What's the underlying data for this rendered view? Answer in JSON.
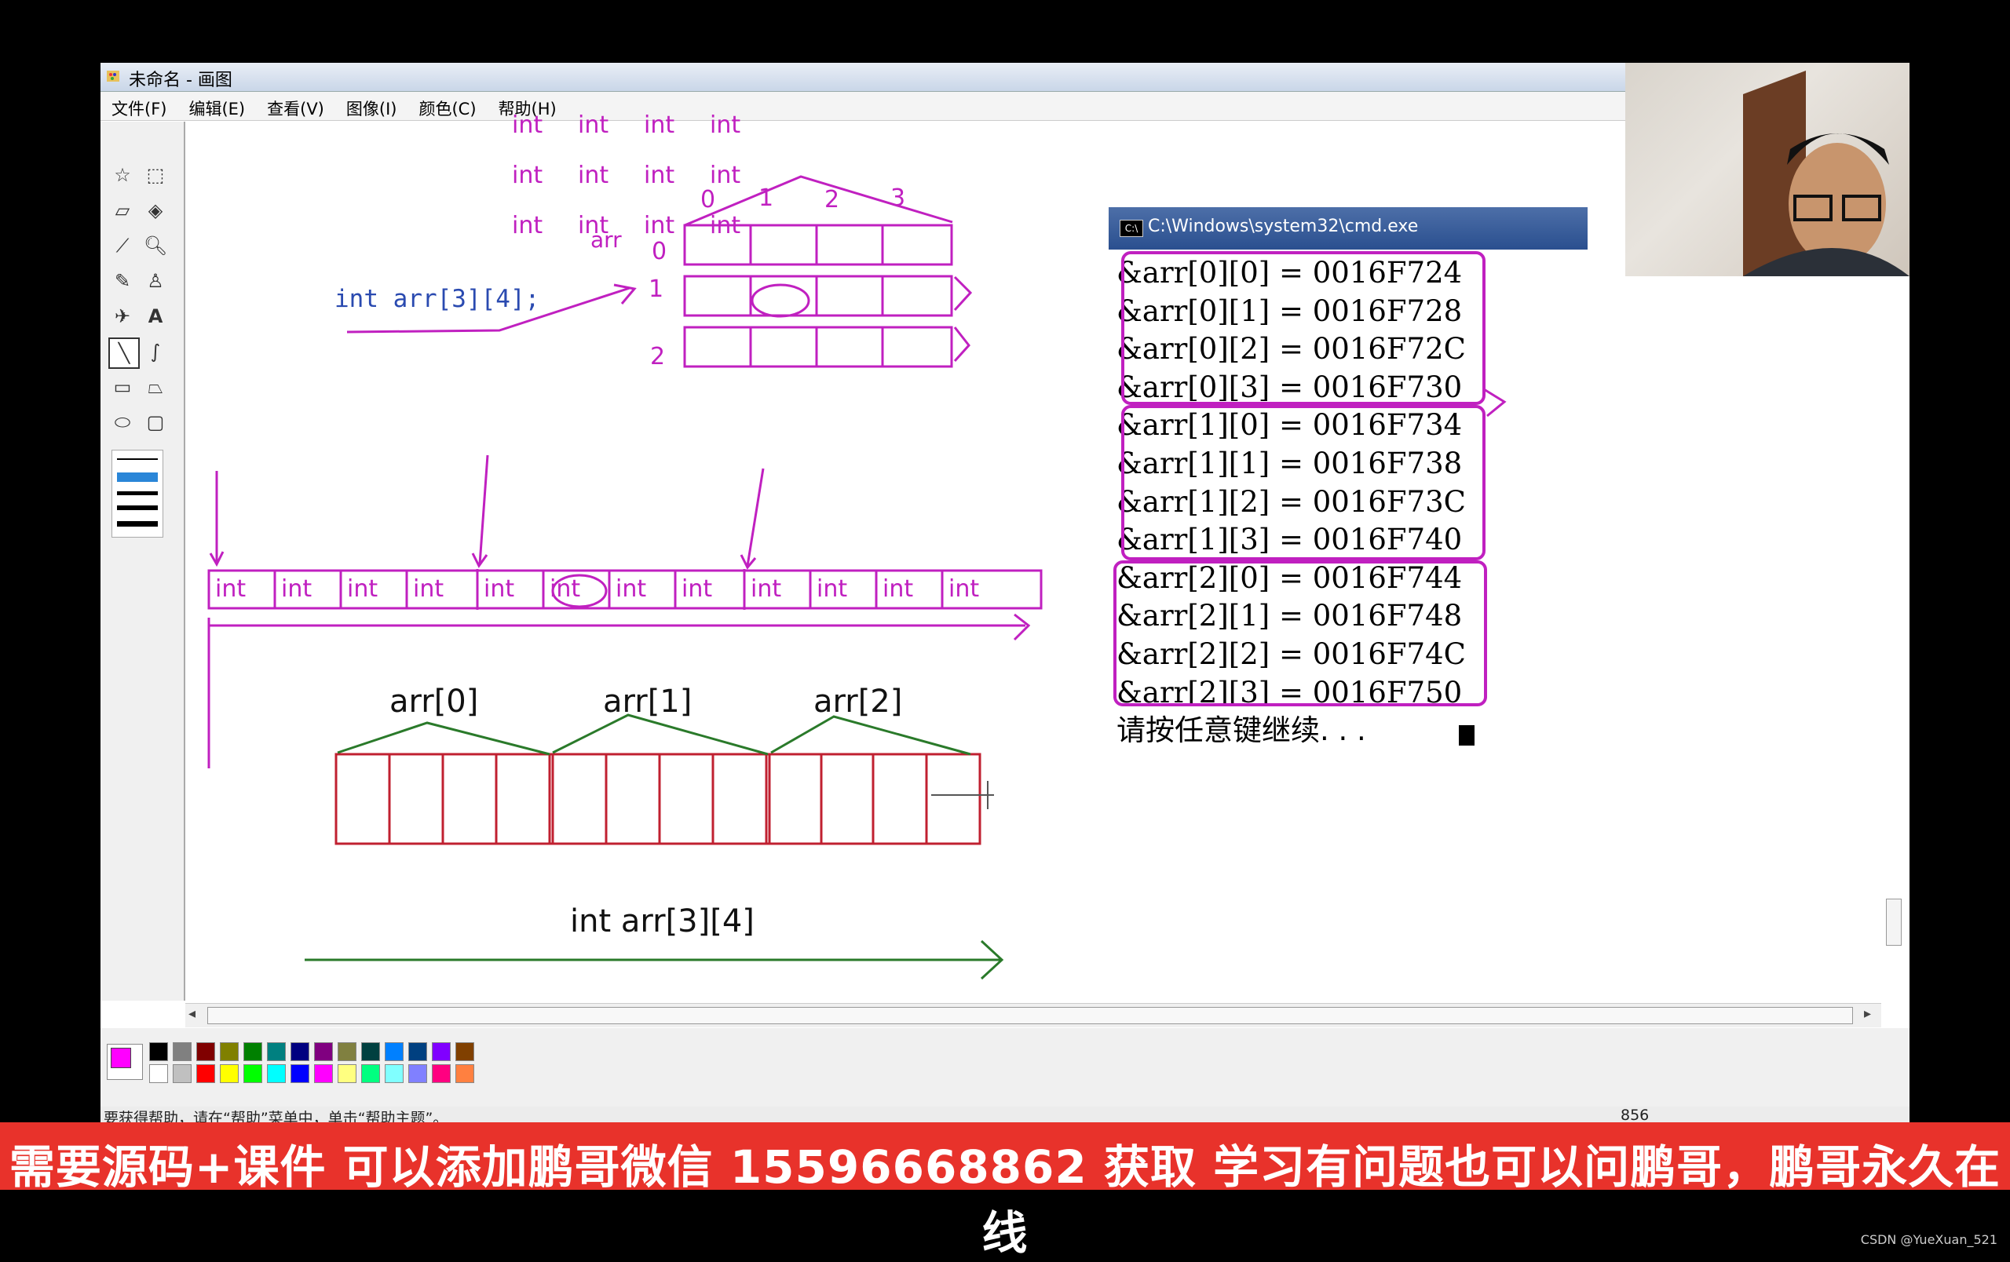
{
  "window": {
    "title": "未命名 - 画图",
    "menu": [
      "文件(F)",
      "编辑(E)",
      "查看(V)",
      "图像(I)",
      "颜色(C)",
      "帮助(H)"
    ]
  },
  "tools": [
    "free-select-icon",
    "rect-select-icon",
    "eraser-icon",
    "fill-icon",
    "color-picker-icon",
    "magnifier-icon",
    "pencil-icon",
    "brush-icon",
    "airbrush-icon",
    "text-icon",
    "line-icon",
    "curve-icon",
    "rectangle-icon",
    "polygon-icon",
    "ellipse-icon",
    "rounded-rect-icon"
  ],
  "drawing": {
    "declaration": "int arr[3][4];",
    "arr_label": "arr",
    "col_indices": [
      "0",
      "1",
      "2",
      "3"
    ],
    "row_indices": [
      "0",
      "1",
      "2"
    ],
    "cell_label": "int",
    "group_labels": [
      "arr[0]",
      "arr[1]",
      "arr[2]"
    ],
    "bottom_label": "int arr[3][4]"
  },
  "cmd": {
    "title": "C:\\Windows\\system32\\cmd.exe",
    "lines": [
      "&arr[0][0] = 0016F724",
      "&arr[0][1] = 0016F728",
      "&arr[0][2] = 0016F72C",
      "&arr[0][3] = 0016F730",
      "&arr[1][0] = 0016F734",
      "&arr[1][1] = 0016F738",
      "&arr[1][2] = 0016F73C",
      "&arr[1][3] = 0016F740",
      "&arr[2][0] = 0016F744",
      "&arr[2][1] = 0016F748",
      "&arr[2][2] = 0016F74C",
      "&arr[2][3] = 0016F750"
    ],
    "prompt": "请按任意键继续. . ."
  },
  "palette": {
    "current": "#ff00ff",
    "row1": [
      "#000000",
      "#808080",
      "#800000",
      "#808000",
      "#008000",
      "#008080",
      "#000080",
      "#800080",
      "#808040",
      "#004040",
      "#0080ff",
      "#004080",
      "#8000ff",
      "#804000"
    ],
    "row2": [
      "#ffffff",
      "#c0c0c0",
      "#ff0000",
      "#ffff00",
      "#00ff00",
      "#00ffff",
      "#0000ff",
      "#ff00ff",
      "#ffff80",
      "#00ff80",
      "#80ffff",
      "#8080ff",
      "#ff0080",
      "#ff8040"
    ]
  },
  "status": {
    "help": "要获得帮助，请在“帮助”菜单中，单击“帮助主题”。",
    "coord": "856"
  },
  "banner": "需要源码+课件 可以添加鹏哥微信 15596668862 获取 学习有问题也可以问鹏哥，鹏哥永久在线",
  "credit": "CSDN @YueXuan_521"
}
